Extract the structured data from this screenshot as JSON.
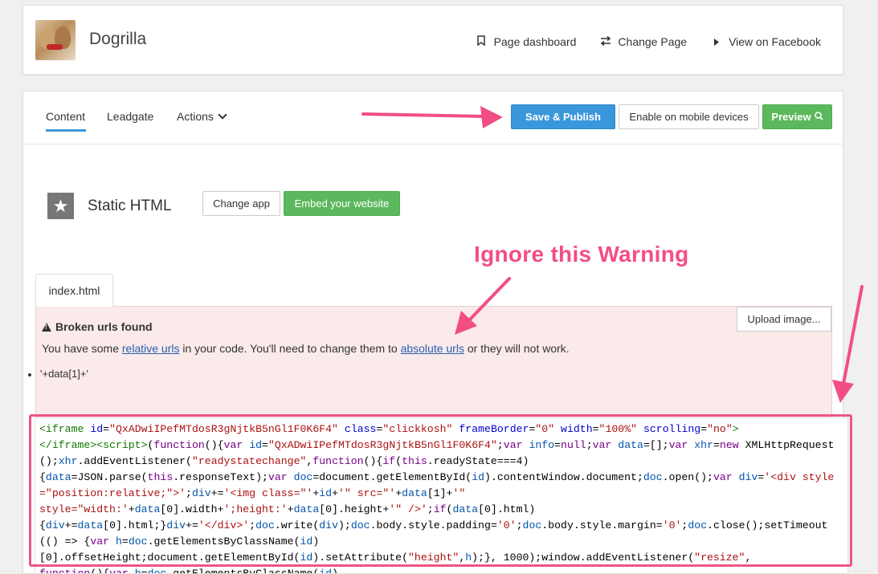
{
  "header": {
    "page_name": "Dogrilla",
    "links": {
      "dashboard": "Page dashboard",
      "change_page": "Change Page",
      "view_fb": "View on Facebook"
    }
  },
  "tabs": {
    "content": "Content",
    "leadgate": "Leadgate",
    "actions": "Actions"
  },
  "toolbar": {
    "save_publish": "Save & Publish",
    "enable_mobile": "Enable on mobile devices",
    "preview": "Preview"
  },
  "app": {
    "title": "Static HTML",
    "change_app": "Change app",
    "embed": "Embed your website"
  },
  "editor": {
    "file_tab": "index.html",
    "upload": "Upload image...",
    "warning_title": "Broken urls found",
    "warning_pre": "You have some ",
    "warning_link1": "relative urls",
    "warning_mid": " in your code. You'll need to change them to ",
    "warning_link2": "absolute urls",
    "warning_post": " or they will not work.",
    "broken_item": "'+data[1]+'"
  },
  "annotation": {
    "text": "Ignore this Warning"
  },
  "colors": {
    "save": "#3a97dc",
    "green": "#5cb85c",
    "annotation": "#f24e84",
    "warning_bg": "#fbeaea"
  },
  "icons": {
    "dashboard": "bookmark-icon",
    "change_page": "swap-arrows-icon",
    "view_fb": "caret-right-icon",
    "actions": "chevron-down-icon",
    "preview": "search-icon",
    "app": "star-icon",
    "warning": "warning-triangle-icon"
  }
}
